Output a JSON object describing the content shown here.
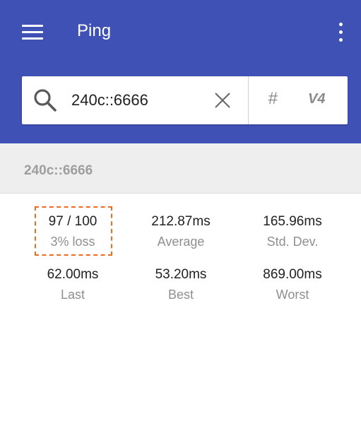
{
  "app": {
    "title": "Ping"
  },
  "search": {
    "value": "240c::6666",
    "hash_label": "#",
    "v4_label": "V4"
  },
  "host": {
    "label": "240c::6666"
  },
  "stats": [
    {
      "value": "97 / 100",
      "label": "3% loss"
    },
    {
      "value": "212.87ms",
      "label": "Average"
    },
    {
      "value": "165.96ms",
      "label": "Std. Dev."
    },
    {
      "value": "62.00ms",
      "label": "Last"
    },
    {
      "value": "53.20ms",
      "label": "Best"
    },
    {
      "value": "869.00ms",
      "label": "Worst"
    }
  ],
  "colors": {
    "appbar": "#3f51b5",
    "highlight_border": "#f26a21",
    "hostbar_bg": "#eeeeee"
  },
  "icons": [
    "menu-icon",
    "more-vert-icon",
    "search-icon",
    "close-icon"
  ]
}
